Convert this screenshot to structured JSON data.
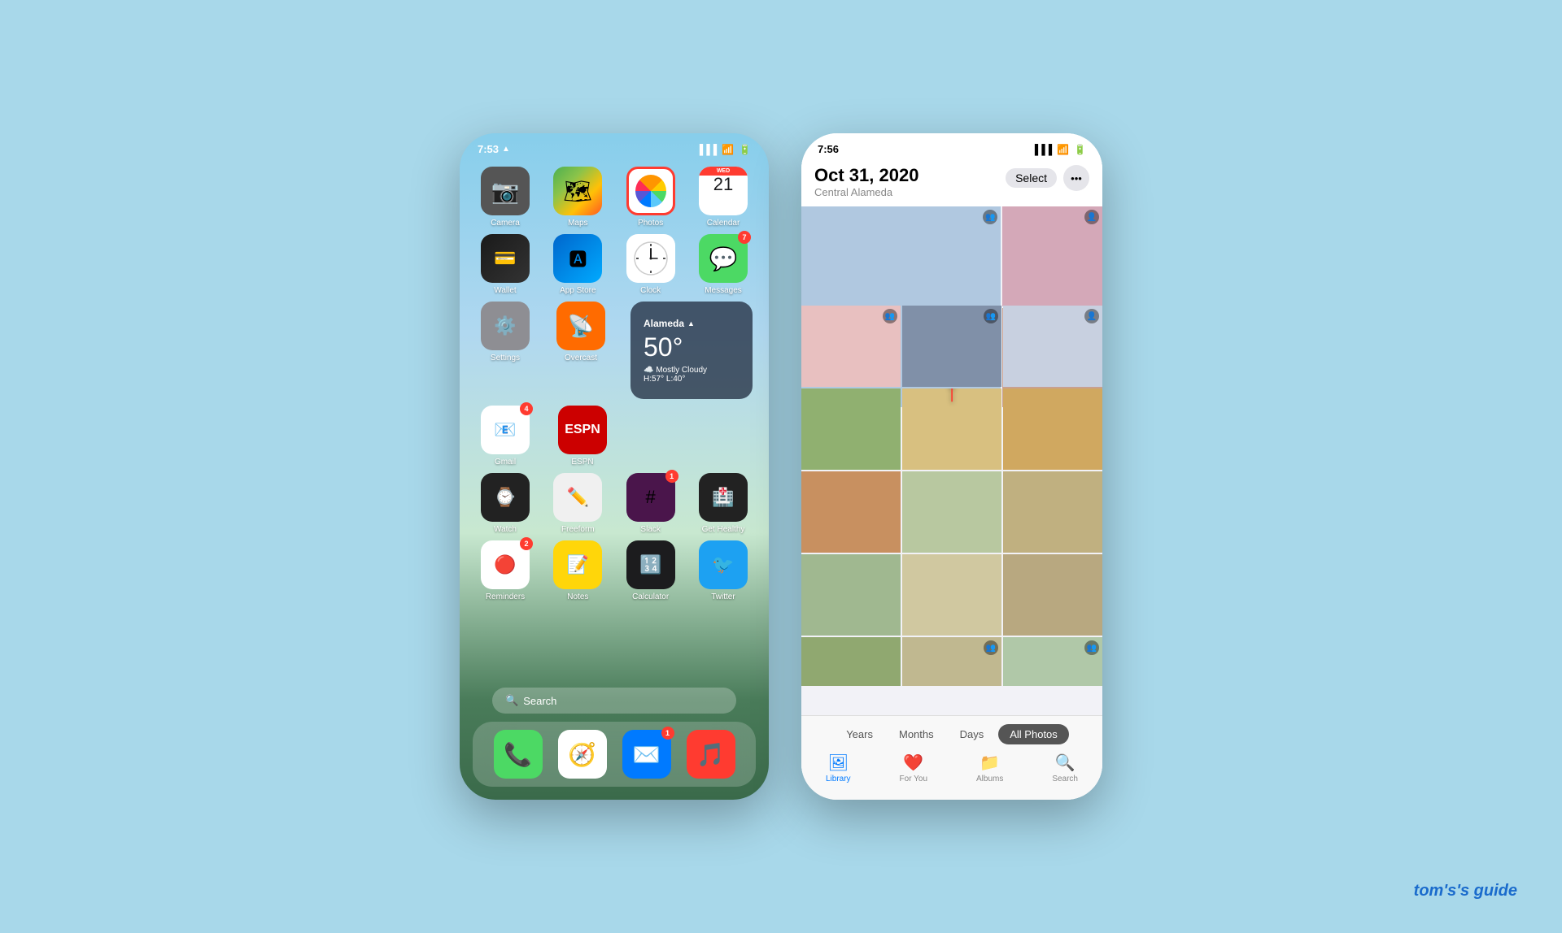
{
  "phone1": {
    "status": {
      "time": "7:53",
      "signal": "▲",
      "wifi": "wifi",
      "battery": "battery"
    },
    "apps_row1": [
      {
        "label": "Camera",
        "icon": "camera"
      },
      {
        "label": "Maps",
        "icon": "maps"
      },
      {
        "label": "Photos",
        "icon": "photos",
        "highlighted": true
      },
      {
        "label": "Calendar",
        "icon": "calendar",
        "day": "21",
        "dayname": "WED"
      }
    ],
    "apps_row2": [
      {
        "label": "Wallet",
        "icon": "wallet"
      },
      {
        "label": "App Store",
        "icon": "appstore"
      },
      {
        "label": "Clock",
        "icon": "clock"
      },
      {
        "label": "Messages",
        "icon": "messages",
        "badge": "7"
      }
    ],
    "apps_row3_left": [
      {
        "label": "Settings",
        "icon": "settings"
      },
      {
        "label": "Overcast",
        "icon": "overcast"
      }
    ],
    "weather": {
      "city": "Alameda",
      "temp": "50°",
      "desc": "Mostly Cloudy",
      "hilo": "H:57° L:40°"
    },
    "apps_row4": [
      {
        "label": "Gmail",
        "icon": "gmail",
        "badge": "4"
      },
      {
        "label": "ESPN",
        "icon": "espn"
      }
    ],
    "apps_row5": [
      {
        "label": "Watch",
        "icon": "watch"
      },
      {
        "label": "Freeform",
        "icon": "freeform"
      },
      {
        "label": "Slack",
        "icon": "slack",
        "badge": "1"
      },
      {
        "label": "Get Healthy",
        "icon": "gethealthy"
      }
    ],
    "apps_row6": [
      {
        "label": "Reminders",
        "icon": "reminders",
        "badge": "2"
      },
      {
        "label": "Notes",
        "icon": "notes"
      },
      {
        "label": "Calculator",
        "icon": "calculator"
      },
      {
        "label": "Twitter",
        "icon": "twitter"
      }
    ],
    "search": "Search",
    "dock": [
      {
        "label": "Phone",
        "icon": "phone"
      },
      {
        "label": "Safari",
        "icon": "safari"
      },
      {
        "label": "Mail",
        "icon": "mail",
        "badge": "1"
      },
      {
        "label": "Music",
        "icon": "music"
      }
    ]
  },
  "phone2": {
    "status": {
      "time": "7:56"
    },
    "header": {
      "date": "Oct 31, 2020",
      "location": "Central Alameda",
      "select_label": "Select"
    },
    "time_tabs": [
      "Years",
      "Months",
      "Days",
      "All Photos"
    ],
    "active_tab": "All Photos",
    "nav_tabs": [
      {
        "label": "Library",
        "icon": "🖼",
        "active": true
      },
      {
        "label": "For You",
        "icon": "❤️"
      },
      {
        "label": "Albums",
        "icon": "📁"
      },
      {
        "label": "Search",
        "icon": "🔍"
      }
    ]
  },
  "watermark": {
    "text": "tom's",
    "suffix": "guide"
  }
}
